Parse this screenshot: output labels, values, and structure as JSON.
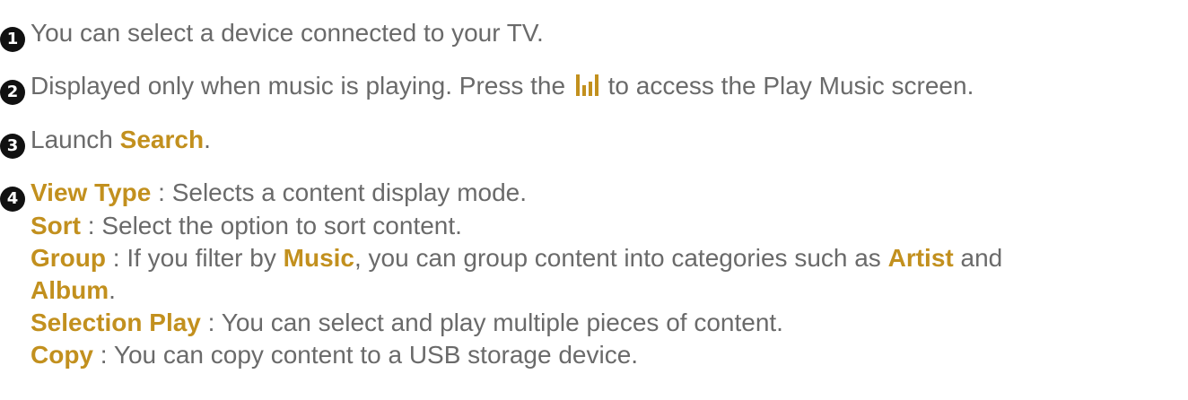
{
  "items": [
    {
      "number": "1",
      "text": "You can select a device connected to your TV."
    },
    {
      "number": "2",
      "text_before": "Displayed only when music is playing. Press the",
      "icon": "music-bars-icon",
      "text_after": "to access the Play Music screen."
    },
    {
      "number": "3",
      "text_before": "Launch",
      "keyword": "Search",
      "text_after": "."
    },
    {
      "number": "4"
    }
  ],
  "options": {
    "view_type": {
      "label": "View Type",
      "desc": " : Selects a content display mode."
    },
    "sort": {
      "label": "Sort",
      "desc": " : Select the option to sort content."
    },
    "group": {
      "label": "Group",
      "desc_1": " : If you filter by ",
      "kw_music": "Music",
      "desc_2": ", you can group content into categories such as ",
      "kw_artist": "Artist",
      "desc_3": " and",
      "kw_album": "Album",
      "desc_4": "."
    },
    "selection_play": {
      "label": "Selection Play",
      "desc": " : You can select and play multiple pieces of content."
    },
    "copy": {
      "label": "Copy",
      "desc": " : You can copy content to a USB storage device."
    }
  },
  "colors": {
    "keyword": "#c2901e",
    "text": "#6a6a6a",
    "bullet": "#111111"
  }
}
